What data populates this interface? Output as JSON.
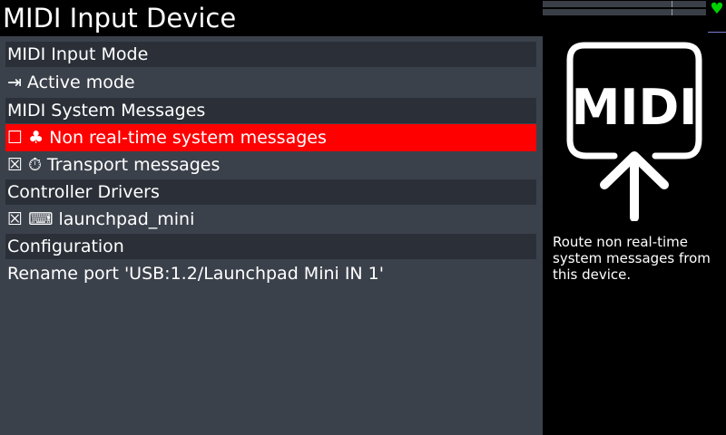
{
  "header": {
    "title": "MIDI Input Device"
  },
  "status": {
    "heart_icon": "heart-icon",
    "heart_color": "#00d000"
  },
  "list": {
    "items": [
      {
        "type": "header",
        "label": "MIDI Input Mode"
      },
      {
        "type": "item",
        "icon": "arrow-to-bar-icon",
        "glyph": "⇥",
        "label": "Active mode"
      },
      {
        "type": "header",
        "label": "MIDI System Messages"
      },
      {
        "type": "item",
        "selected": true,
        "icon": "checkbox-unchecked-icon",
        "glyph": "☐ ♣",
        "label": "Non real-time system messages"
      },
      {
        "type": "item",
        "icon": "checkbox-checked-icon",
        "glyph": "☒ ⏱",
        "label": "Transport messages"
      },
      {
        "type": "header",
        "label": "Controller Drivers"
      },
      {
        "type": "item",
        "icon": "keyboard-icon",
        "glyph": "☒ ⌨",
        "label": "launchpad_mini"
      },
      {
        "type": "header",
        "label": "Configuration"
      },
      {
        "type": "item",
        "label": "Rename port 'USB:1.2/Launchpad Mini IN 1'"
      }
    ]
  },
  "info": {
    "logo_text": "MIDI",
    "logo_icon": "midi-input-arrow-icon",
    "description": "Route non real-time system messages from this device."
  },
  "colors": {
    "selected": "#ff0000",
    "panel_bg": "#3b414b",
    "header_bg": "#2b3038"
  }
}
